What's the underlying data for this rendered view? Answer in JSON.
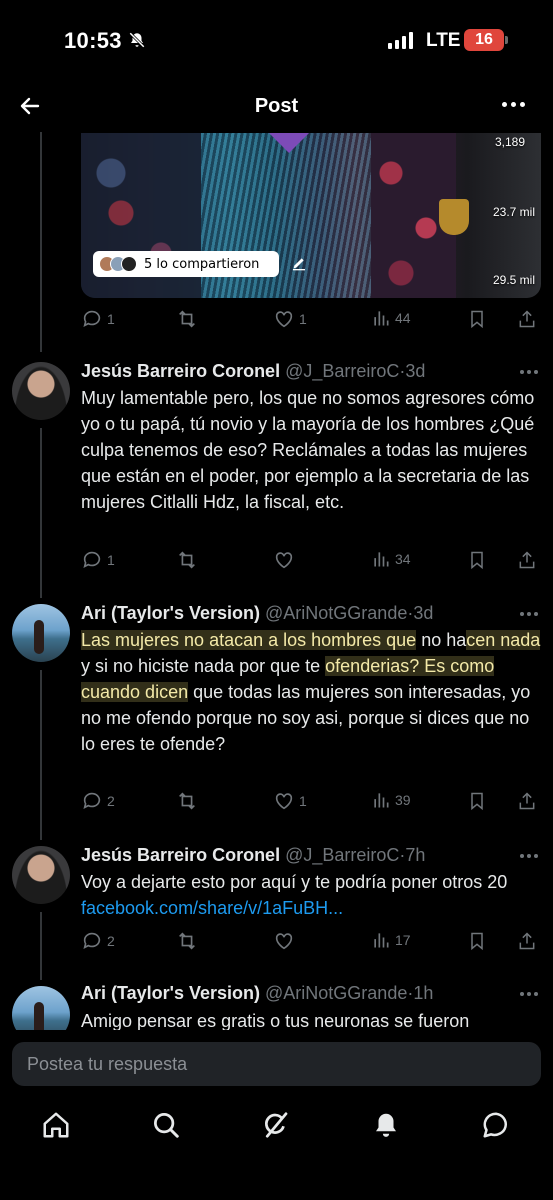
{
  "status_bar": {
    "time": "10:53",
    "network": "LTE",
    "battery": "16"
  },
  "header": {
    "title": "Post"
  },
  "media": {
    "count_top": "3,189",
    "count_mid": "23.7 mil",
    "count_bottom": "29.5 mil",
    "shared_text": "5 lo compartieron"
  },
  "first_actions": {
    "replies": "1",
    "reposts": "",
    "likes": "1",
    "views": "44"
  },
  "tweets": [
    {
      "name": "Jesús Barreiro Coronel",
      "handle": "@J_BarreiroC",
      "time": "3d",
      "text": "Muy lamentable pero, los que no somos agresores cómo yo o tu papá, tú novio y la mayoría de los hombres ¿Qué culpa tenemos de eso? Reclámales a todas las mujeres que están en el poder, por ejemplo a la secretaria de las mujeres Citlalli Hdz, la fiscal, etc.",
      "replies": "1",
      "reposts": "",
      "likes": "",
      "views": "34"
    },
    {
      "name": "Ari (Taylor's Version)",
      "handle": "@AriNotGGrande",
      "time": "3d",
      "text_parts": [
        "Las mujeres no atacan a los hombres que",
        " no ha",
        "cen nada",
        " y si no hiciste nada por que te ",
        "ofenderias? Es como cuando dicen",
        " que todas las mujeres son interesadas, yo no me ofendo porque no soy asi, porque si dices que no lo eres te ofende?"
      ],
      "replies": "2",
      "reposts": "",
      "likes": "1",
      "views": "39"
    },
    {
      "name": "Jesús Barreiro Coronel",
      "handle": "@J_BarreiroC",
      "time": "7h",
      "text": "Voy a dejarte esto por aquí y te podría poner otros 20 ",
      "link": "facebook.com/share/v/1aFuBH...",
      "replies": "2",
      "reposts": "",
      "likes": "",
      "views": "17"
    },
    {
      "name": "Ari (Taylor's Version)",
      "handle": "@AriNotGGrande",
      "time": "1h",
      "text": "Amigo pensar es gratis o tus neuronas se fueron"
    }
  ],
  "reply": {
    "placeholder": "Postea tu respuesta"
  },
  "tabs": [
    "home-icon",
    "search-icon",
    "grok-icon",
    "notifications-icon",
    "messages-icon"
  ]
}
